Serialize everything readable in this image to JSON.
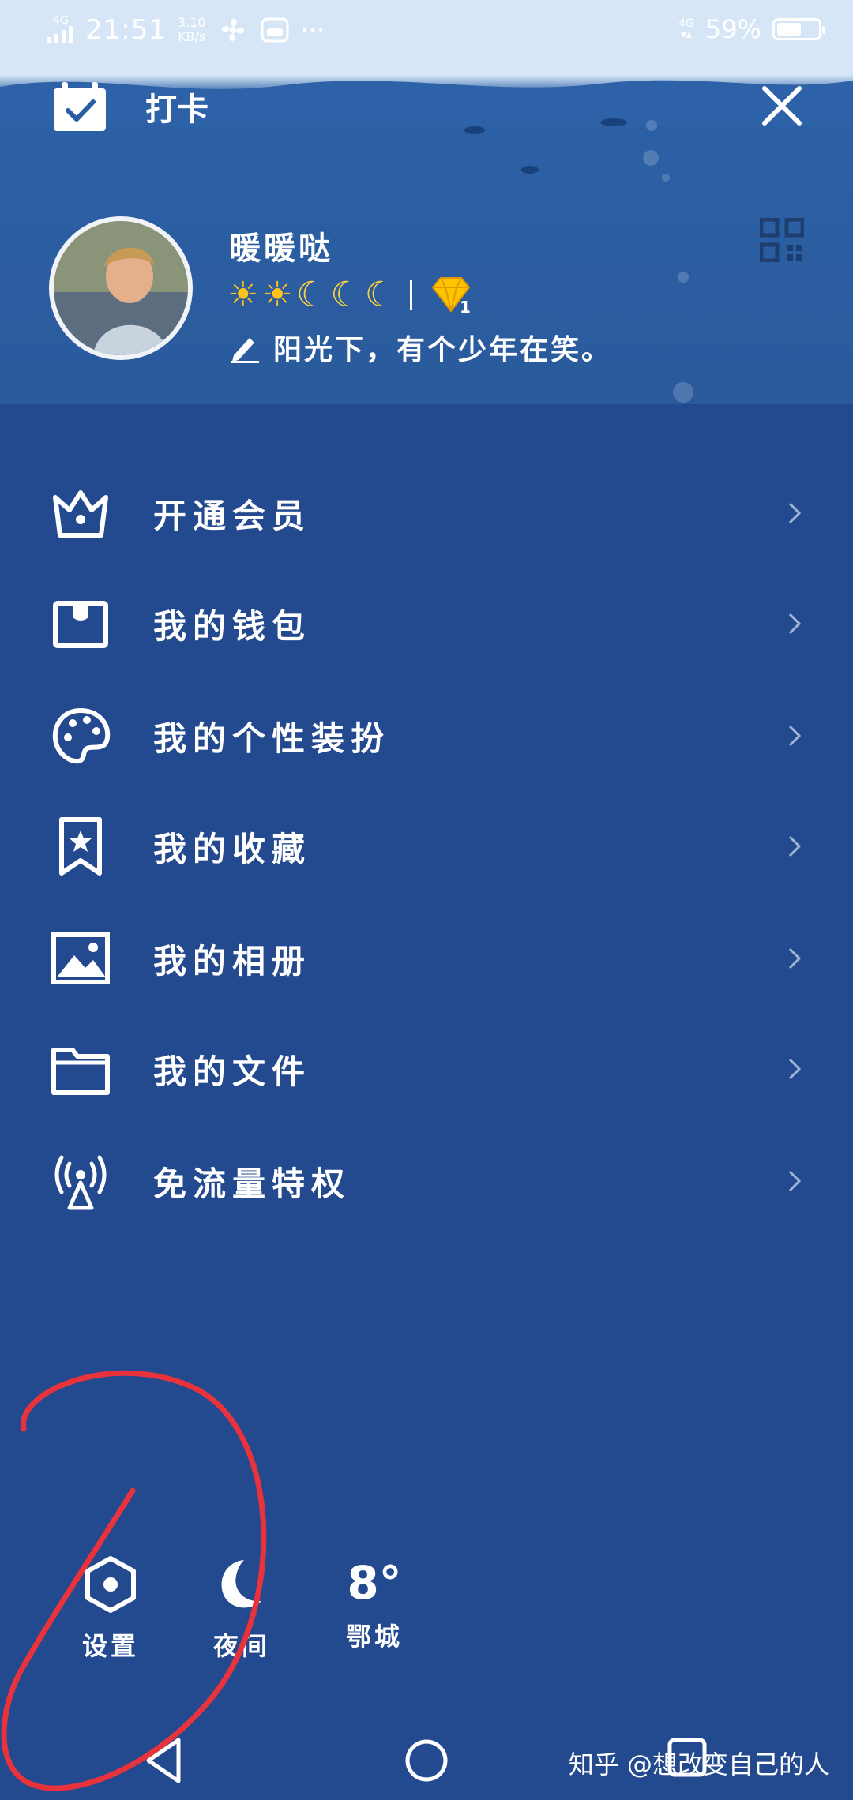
{
  "status_bar": {
    "network_left": "4G",
    "time": "21:51",
    "speed_value": "3.10",
    "speed_unit": "KB/s",
    "more": "···",
    "network_right": "4G",
    "battery_percent": "59%",
    "battery_level": 0.59
  },
  "header": {
    "checkin_label": "打卡",
    "username": "暖暖哒",
    "level_icons": [
      "sun-icon",
      "sun-icon",
      "moon-icon",
      "moon-icon",
      "moon-icon"
    ],
    "diamond_level": "1",
    "signature": "阳光下，有个少年在笑。"
  },
  "menu": {
    "items": [
      {
        "label": "开通会员",
        "icon": "crown-icon"
      },
      {
        "label": "我的钱包",
        "icon": "wallet-icon"
      },
      {
        "label": "我的个性装扮",
        "icon": "palette-icon"
      },
      {
        "label": "我的收藏",
        "icon": "bookmark-star-icon"
      },
      {
        "label": "我的相册",
        "icon": "photo-icon"
      },
      {
        "label": "我的文件",
        "icon": "folder-icon"
      },
      {
        "label": "免流量特权",
        "icon": "signal-tower-icon"
      }
    ]
  },
  "bottom": {
    "settings_label": "设置",
    "night_label": "夜间",
    "weather_temp": "8°",
    "weather_city": "鄂城"
  },
  "watermark": "知乎 @想改变自己的人",
  "colors": {
    "background": "#23498f",
    "header_sky": "#d6e6f6",
    "sun": "#ffc21a",
    "diamond": "#ffc400",
    "annotation": "#e8323c"
  }
}
